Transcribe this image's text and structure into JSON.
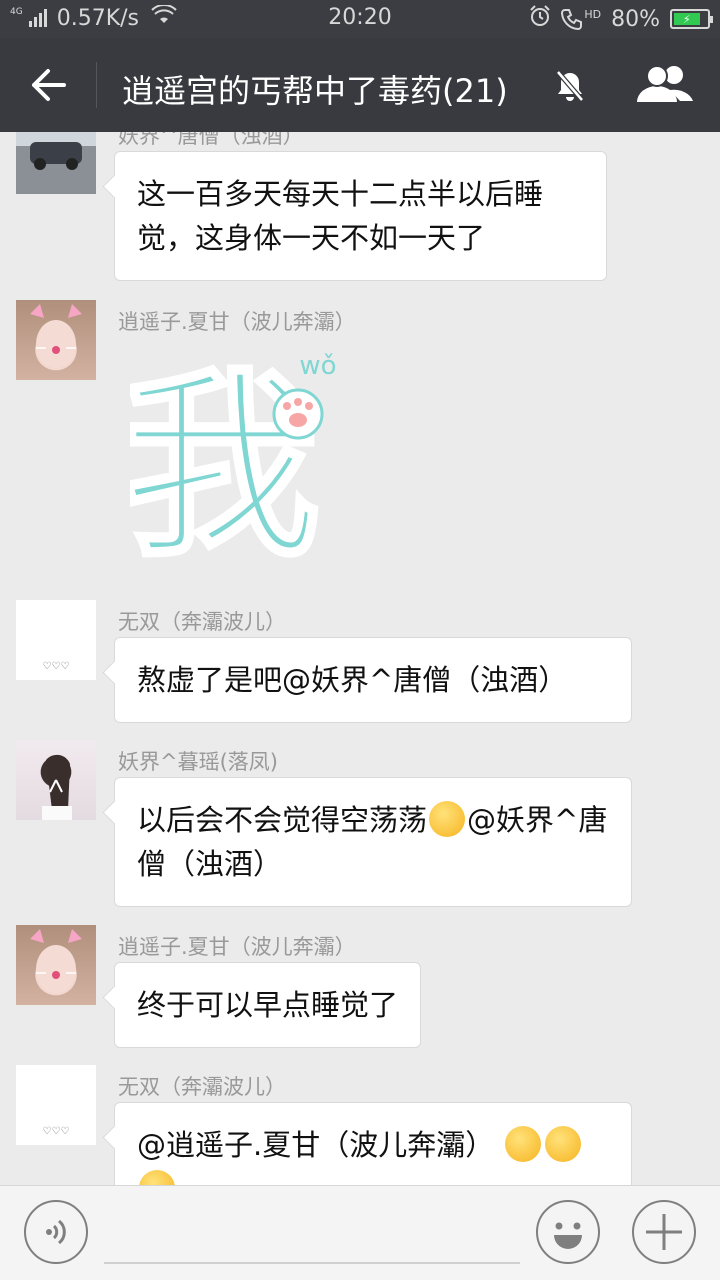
{
  "status_bar": {
    "network": "4G",
    "speed": "0.57K/s",
    "time": "20:20",
    "hd_label": "HD",
    "battery": "80%",
    "battery_level": 0.8
  },
  "header": {
    "title": "逍遥宫的丐帮中了毒药(21)"
  },
  "messages": [
    {
      "sender": "妖界^唐僧（浊酒）",
      "text": "这一百多天每天十二点半以后睡觉，这身体一天不如一天了"
    },
    {
      "sender": "逍遥子.夏甘（波儿奔灞）",
      "sticker_char": "我",
      "sticker_pinyin": "wǒ"
    },
    {
      "sender": "无双（奔灞波儿）",
      "avatar_mark": "♡♡♡",
      "text": "熬虚了是吧@妖界^唐僧（浊酒）"
    },
    {
      "sender": "妖界^暮瑶(落凤)",
      "text_before_emoji": "以后会不会觉得空荡荡",
      "text_after_emoji": "@妖界^唐僧（浊酒）"
    },
    {
      "sender": "逍遥子.夏甘（波儿奔灞）",
      "text": "终于可以早点睡觉了"
    },
    {
      "sender": "无双（奔灞波儿）",
      "avatar_mark": "♡♡♡",
      "text": "@逍遥子.夏甘（波儿奔灞）"
    }
  ],
  "colors": {
    "title_bar": "#393a3f",
    "status_bar": "#3c3d42",
    "chat_background": "#ebebeb",
    "bubble": "#ffffff",
    "sticker": "#7fd6d2"
  },
  "icons": {
    "back": "arrow-left-icon",
    "mute": "bell-off-icon",
    "group": "group-members-icon",
    "voice": "voice-icon",
    "emoji": "smiley-icon",
    "plus": "plus-icon"
  }
}
